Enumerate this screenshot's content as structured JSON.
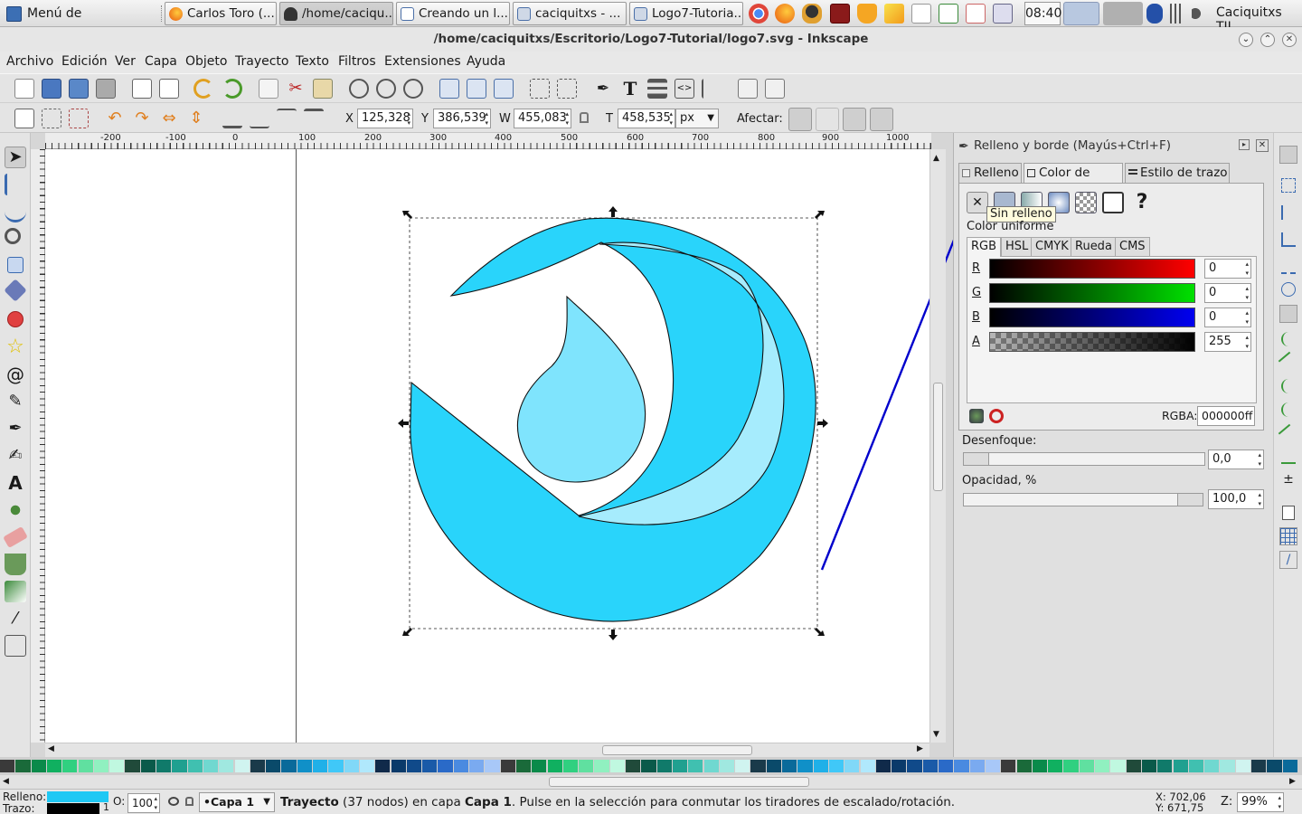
{
  "taskbar": {
    "apps_menu": "Menú de aplicaciones",
    "windows": [
      {
        "label": "Carlos Toro (..."
      },
      {
        "label": "/home/caciqu..."
      },
      {
        "label": "Creando un l..."
      },
      {
        "label": "caciquitxs - ..."
      },
      {
        "label": "Logo7-Tutoria..."
      }
    ],
    "clock": "08:40",
    "user": "Caciquitxs TIL"
  },
  "window": {
    "title": "/home/caciquitxs/Escritorio/Logo7-Tutorial/logo7.svg - Inkscape"
  },
  "menubar": [
    "Archivo",
    "Edición",
    "Ver",
    "Capa",
    "Objeto",
    "Trayecto",
    "Texto",
    "Filtros",
    "Extensiones",
    "Ayuda"
  ],
  "controls": {
    "x_label": "X",
    "x_value": "125,328",
    "y_label": "Y",
    "y_value": "386,539",
    "w_label": "W",
    "w_value": "455,083",
    "h_label": "T",
    "h_value": "458,535",
    "unit": "px",
    "affect_label": "Afectar:"
  },
  "ruler": {
    "h_ticks": [
      "-200",
      "-100",
      "0",
      "100",
      "200",
      "300",
      "400",
      "500",
      "600",
      "700",
      "800",
      "900",
      "1000"
    ]
  },
  "dialog": {
    "title": "Relleno y borde (Mayús+Ctrl+F)",
    "tabs": [
      "Relleno",
      "Color de trazo",
      "Estilo de trazo"
    ],
    "tooltip": "Sin relleno",
    "uniform_color": "Color uniforme",
    "color_tabs": [
      "RGB",
      "HSL",
      "CMYK",
      "Rueda",
      "CMS"
    ],
    "channels": [
      {
        "label": "R",
        "value": "0"
      },
      {
        "label": "G",
        "value": "0"
      },
      {
        "label": "B",
        "value": "0"
      },
      {
        "label": "A",
        "value": "255"
      }
    ],
    "rgba_label": "RGBA:",
    "rgba_value": "000000ff",
    "blur_label": "Desenfoque:",
    "blur_value": "0,0",
    "opacity_label": "Opacidad, %",
    "opacity_value": "100,0"
  },
  "statusbar": {
    "fill_label": "Relleno:",
    "stroke_label": "Trazo:",
    "stroke_width": "1",
    "opacity_label": "O:",
    "opacity_value": "100",
    "layer": "•Capa 1",
    "message_bold": "Trayecto",
    "message": " (37 nodos) en capa ",
    "message_layer": "Capa 1",
    "message_tail": ". Pulse en la selección para conmutar los tiradores de escalado/rotación.",
    "coord_x": "X: 702,06",
    "coord_y": "Y: 671,75",
    "zoom_label": "Z:",
    "zoom_value": "99%"
  },
  "colors": {
    "logo_main": "#29d4fb",
    "logo_light": "#7fe4fd",
    "logo_crescent": "#a6ecfd",
    "fill_indicator": "#1ec8f4",
    "stroke_indicator": "#000000",
    "arrow": "#0000cc"
  }
}
